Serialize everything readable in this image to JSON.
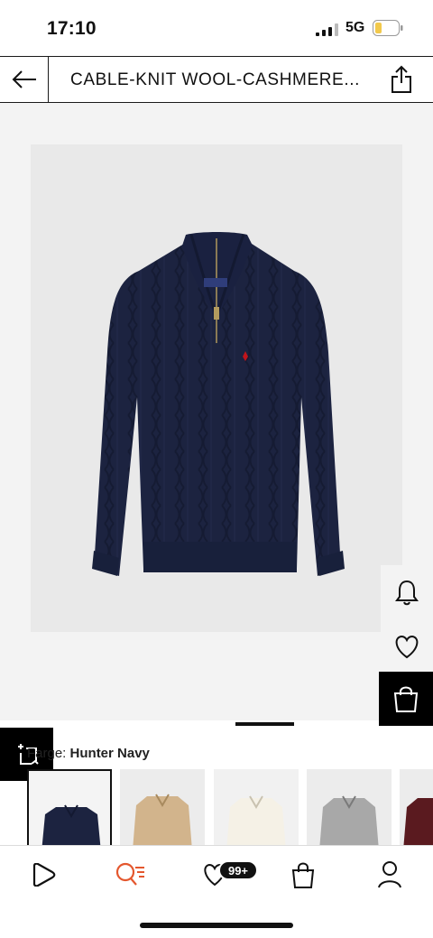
{
  "status_bar": {
    "time": "17:10",
    "network": "5G",
    "signal_icon": "signal-bars-icon",
    "battery_icon": "battery-low-icon",
    "battery_color": "#f2c94c"
  },
  "header": {
    "title": "CABLE-KNIT WOOL-CASHMERE...",
    "back_icon": "arrow-left-icon",
    "share_icon": "share-icon"
  },
  "gallery": {
    "image_alt": "Navy cable-knit quarter-zip sweater",
    "product_color": "#1c2340",
    "logo_color": "#c0141b",
    "action_icons": [
      "bell-icon",
      "heart-icon",
      "shopping-bag-icon",
      "compare-icon"
    ]
  },
  "color_section": {
    "label": "Farge:",
    "selected_color": "Hunter Navy",
    "swatches": [
      {
        "name": "Hunter Navy",
        "color": "#1c2340",
        "selected": true
      },
      {
        "name": "Camel",
        "color": "#d2b48c",
        "selected": false
      },
      {
        "name": "Cream",
        "color": "#f1ece0",
        "selected": false
      },
      {
        "name": "Grey",
        "color": "#a8a8a8",
        "selected": false
      },
      {
        "name": "Burgundy",
        "color": "#5a1a1f",
        "selected": false
      }
    ]
  },
  "bottom_nav": {
    "items": [
      "home-icon",
      "search-icon",
      "wishlist-icon",
      "bag-icon",
      "account-icon"
    ],
    "wishlist_badge": "99+",
    "accent_color": "#e4572e"
  }
}
